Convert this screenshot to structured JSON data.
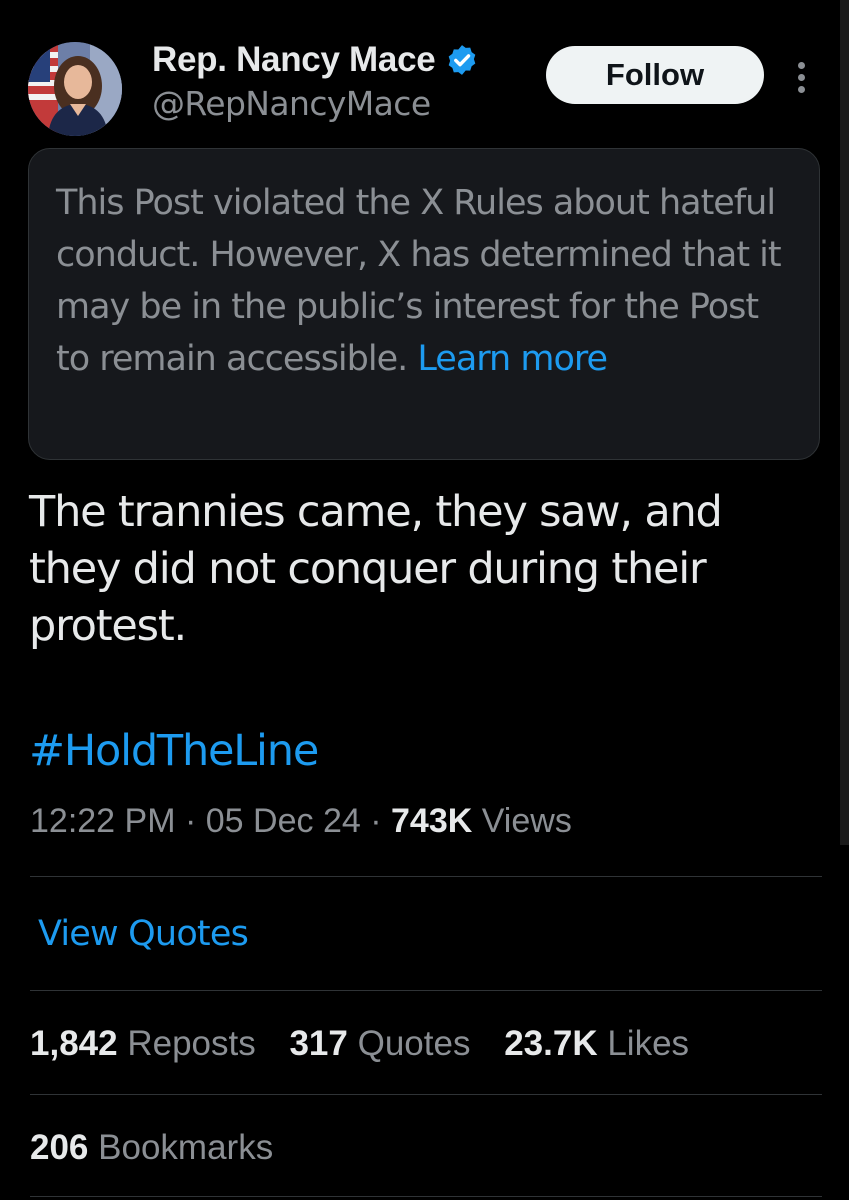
{
  "author": {
    "display_name": "Rep. Nancy Mace",
    "handle": "@RepNancyMace",
    "verified": true,
    "verified_color": "#1d9bf0"
  },
  "header": {
    "follow_label": "Follow",
    "more_icon": "more-vertical-icon"
  },
  "notice": {
    "text": "This Post violated the X Rules about hateful conduct. However, X has determined that it may be in the public’s interest for the Post to remain accessible.",
    "link_label": "Learn more"
  },
  "post": {
    "text": "The trannies came, they saw, and they did not conquer during their protest.",
    "hashtag": "#HoldTheLine",
    "time": "12:22 PM",
    "date": "05 Dec 24",
    "views_count": "743K",
    "views_label": "Views",
    "separator": "·"
  },
  "actions": {
    "view_quotes_label": "View Quotes"
  },
  "stats": {
    "reposts": {
      "count": "1,842",
      "label": "Reposts"
    },
    "quotes": {
      "count": "317",
      "label": "Quotes"
    },
    "likes": {
      "count": "23.7K",
      "label": "Likes"
    },
    "bookmarks": {
      "count": "206",
      "label": "Bookmarks"
    }
  },
  "colors": {
    "background": "#000000",
    "text_primary": "#e7e9ea",
    "text_secondary": "#8b8f94",
    "accent": "#1d9bf0",
    "notice_bg": "#16181c",
    "border": "#2f3336"
  }
}
